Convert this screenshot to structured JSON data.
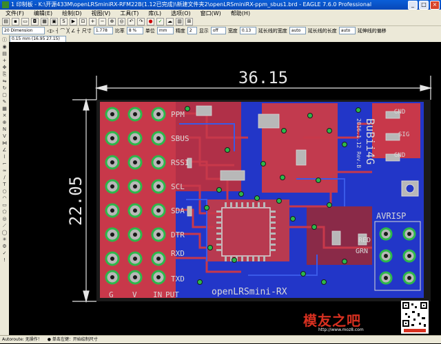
{
  "window": {
    "title": "1 印制板 - K:\\开源433M\\openLRSminiRX-RFM22B(1.12已完成)\\新建文件夹2\\openLRSminiRX-ppm_sbus1.brd - EAGLE 7.6.0 Professional",
    "buttons": [
      "_",
      "□",
      "×"
    ]
  },
  "menu": [
    "文件(F)",
    "编辑(E)",
    "绘制(D)",
    "视图(V)",
    "工具(T)",
    "库(L)",
    "选项(O)",
    "窗口(W)",
    "帮助(H)"
  ],
  "toolbar2": {
    "layer": "20 Dimension",
    "size_label": "尺寸",
    "size_value": "1.778",
    "ratio_label": "比率",
    "ratio_value": "8 %",
    "unit_label": "单位",
    "unit_value": "mm",
    "precision_label": "精度",
    "precision_value": "2",
    "display_label": "显示",
    "display_value": "off",
    "width_label": "宽度",
    "width_value": "0.13",
    "ext_width_label": "延长线的宽度",
    "ext_width_value": "auto",
    "ext_len_label": "延长线的长度",
    "ext_len_value": "auto",
    "ext_offset_label": "延伸线的偏移"
  },
  "coordinates": "0.15 mm (16.95 27.15)",
  "board": {
    "dim_x": "36.15",
    "dim_y": "22.05",
    "title": "openLRSmini-RX",
    "pin_labels": [
      "PPM",
      "SBUS",
      "RSSI",
      "SCL",
      "SDA",
      "DTR",
      "RXD",
      "TXD"
    ],
    "header_labels": [
      "G",
      "V",
      "IN",
      "PUT"
    ],
    "right_labels": [
      "AVRISP",
      "RED",
      "GRN",
      "GND",
      "SIG",
      "GND"
    ],
    "rot_text": "BuBii4G",
    "rot_sub": "2016.1.12 Rev.B"
  },
  "status": {
    "left": "Autoroute: 无操作！",
    "hint": "● 单击左键：开始绘制尺寸"
  },
  "watermark": {
    "text": "模友之吧",
    "url": "http://www.moz8.com"
  },
  "colors": {
    "bottom": "#2236c8",
    "top": "#c8384a",
    "silk": "#d9d9d9",
    "via": "#2db84a",
    "pad": "#b8b8b8",
    "dimension": "#e6e6e6"
  }
}
